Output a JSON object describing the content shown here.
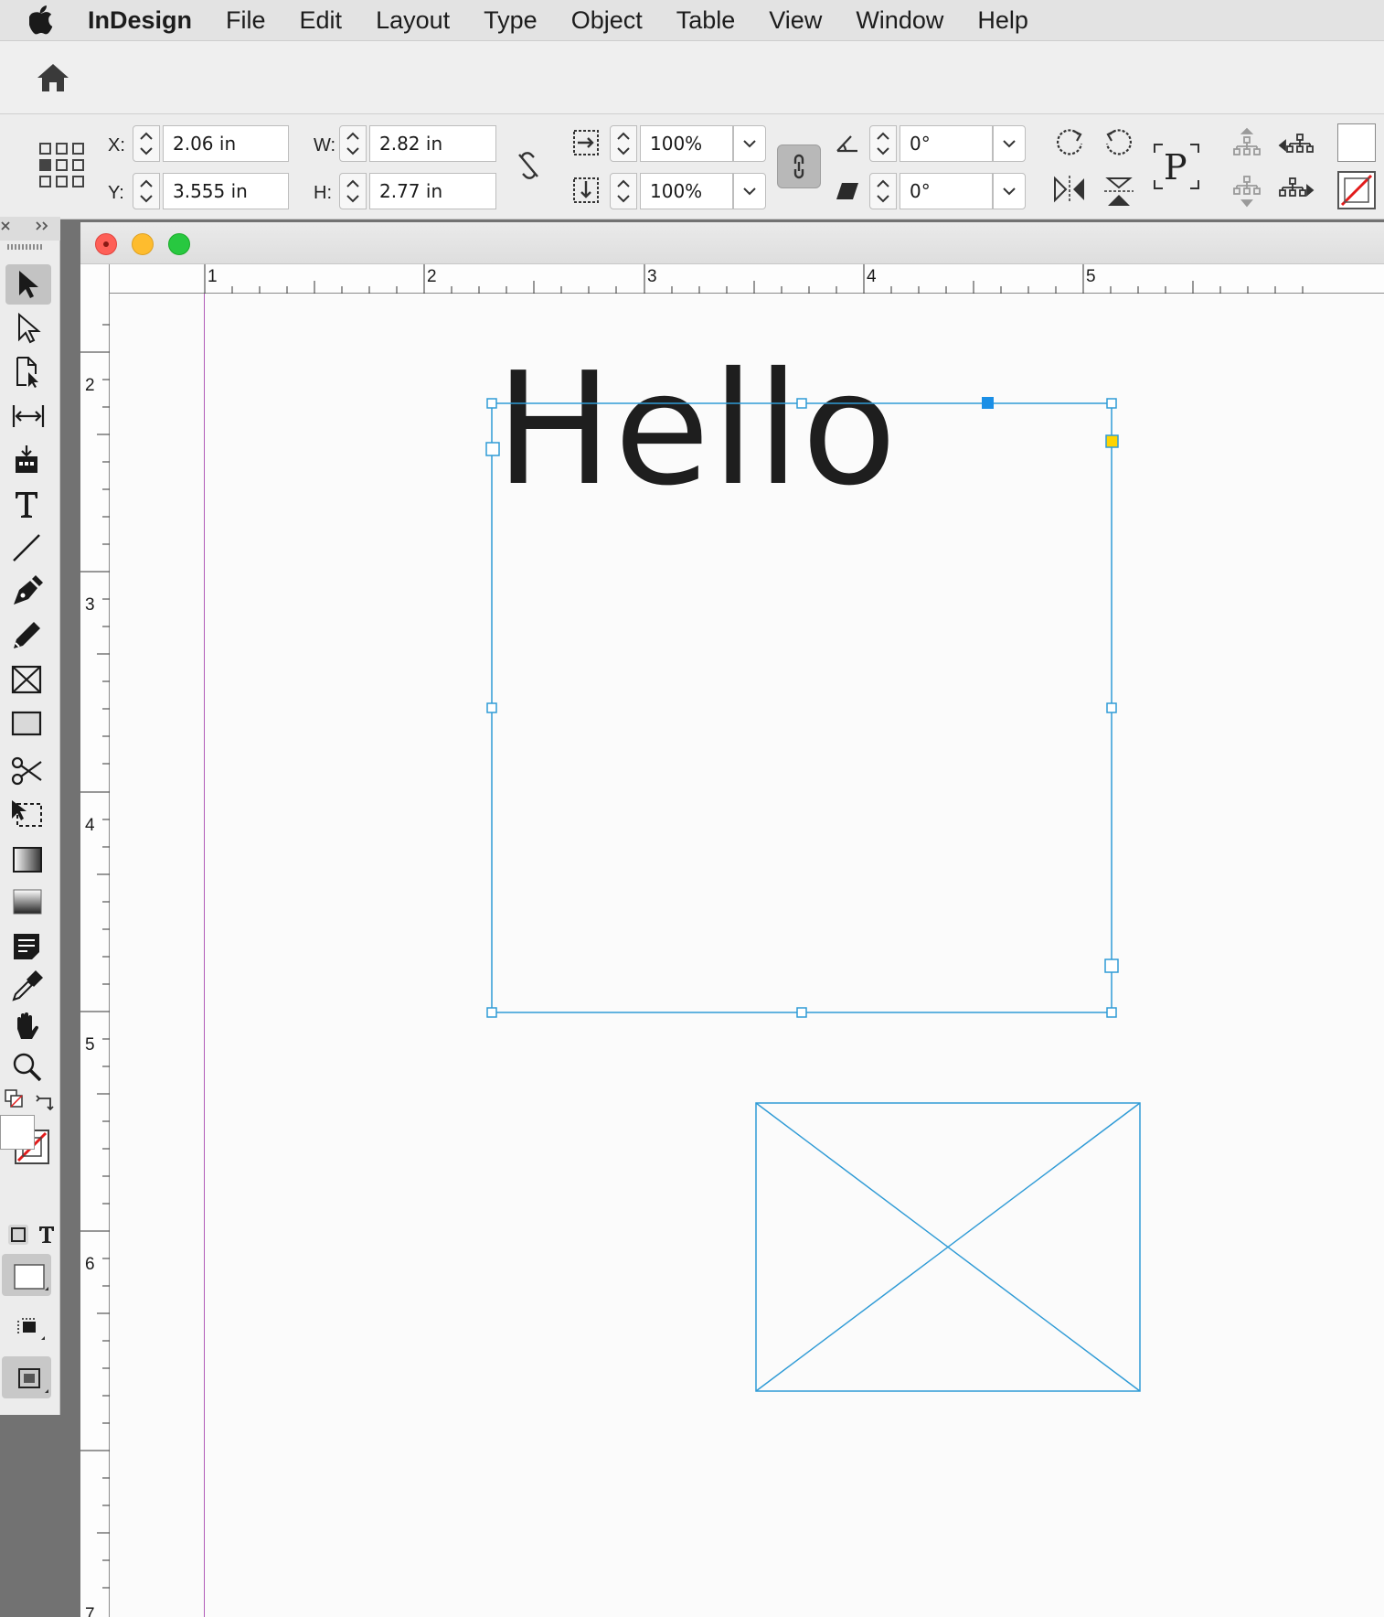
{
  "menubar": {
    "app_name": "InDesign",
    "items": [
      "File",
      "Edit",
      "Layout",
      "Type",
      "Object",
      "Table",
      "View",
      "Window",
      "Help"
    ]
  },
  "control": {
    "x_label": "X:",
    "x_value": "2.06 in",
    "y_label": "Y:",
    "y_value": "3.555 in",
    "w_label": "W:",
    "w_value": "2.82 in",
    "h_label": "H:",
    "h_value": "2.77 in",
    "scale_x": "100%",
    "scale_y": "100%",
    "rotation": "0°",
    "shear": "0°",
    "paragraph_glyph": "P"
  },
  "rulers": {
    "horizontal": [
      "1",
      "2",
      "3",
      "4",
      "5"
    ],
    "vertical": [
      "2",
      "3",
      "4",
      "5",
      "6",
      "7"
    ]
  },
  "canvas": {
    "text_frame_content": "Hello"
  },
  "colors": {
    "selection": "#2f9bd6",
    "margin_guide": "#b15bb8",
    "close": "#fe5f57",
    "minimize": "#febc2e",
    "zoom": "#28c840"
  }
}
